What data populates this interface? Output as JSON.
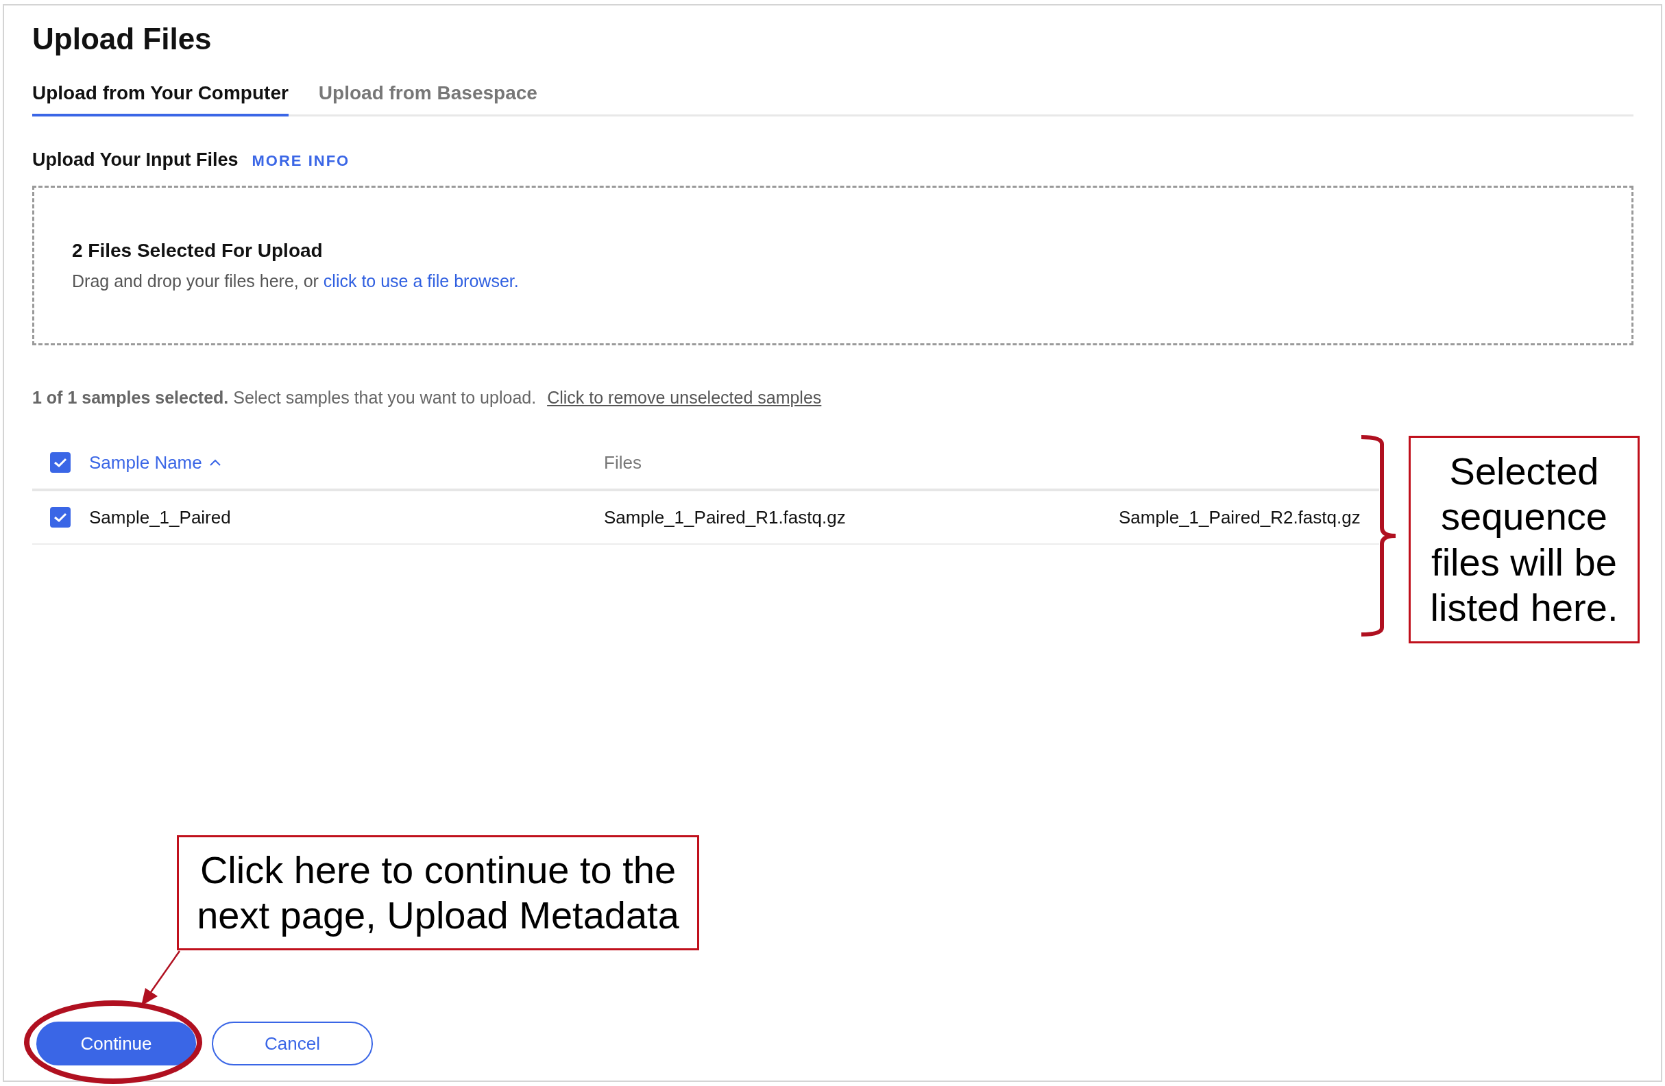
{
  "title": "Upload Files",
  "tabs": [
    {
      "label": "Upload from Your Computer",
      "selected": true
    },
    {
      "label": "Upload from Basespace",
      "selected": false
    }
  ],
  "input_files": {
    "label": "Upload Your Input Files",
    "more_info": "MORE INFO"
  },
  "dropzone": {
    "heading": "2 Files Selected For Upload",
    "text": "Drag and drop your files here, or ",
    "link": "click to use a file browser."
  },
  "selection": {
    "summary": "**1 of 1 samples selected.** Select samples that you want to upload.",
    "remove_link": "Click to remove unselected samples"
  },
  "table": {
    "select_all": {
      "checked": true
    },
    "columns": [
      {
        "label": "Sample Name",
        "sorted": true
      },
      {
        "label": "Files",
        "sorted": false
      }
    ],
    "rows": [
      {
        "checked": true,
        "cells": [
          "Sample_1_Paired",
          "Sample_1_Paired_R1.fastq.gz",
          "Sample_1_Paired_R2.fastq.gz"
        ]
      }
    ]
  },
  "buttons": [
    {
      "label": "Continue",
      "kind": "primary"
    },
    {
      "label": "Cancel",
      "kind": "secondary"
    }
  ],
  "annotations": [
    {
      "kind": "brace-callout",
      "text": "Selected sequence files will be listed here."
    },
    {
      "kind": "arrow-callout",
      "text": "Click here to continue to the next page, Upload Metadata"
    }
  ]
}
